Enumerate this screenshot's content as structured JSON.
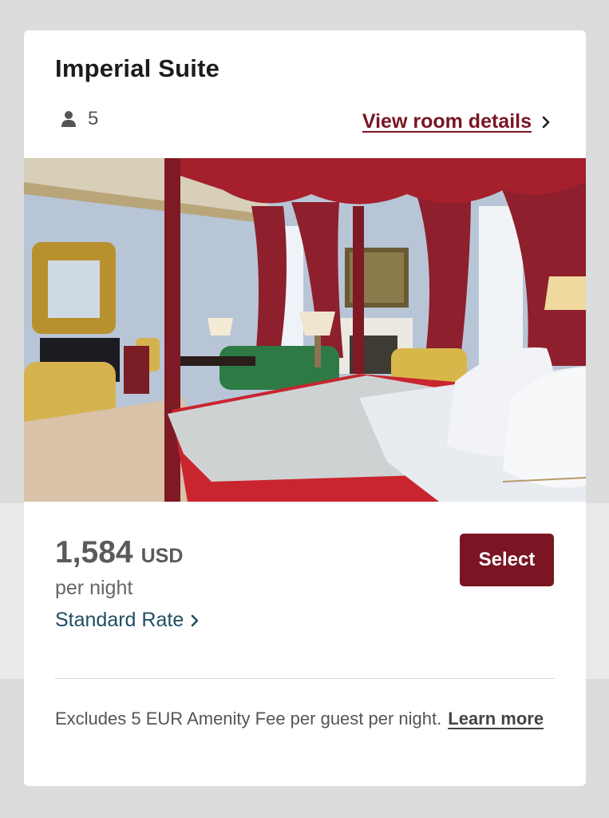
{
  "room": {
    "name": "Imperial Suite",
    "occupancy": "5",
    "details_link": "View room details",
    "photo_icon": "hotel-room-photo"
  },
  "pricing": {
    "amount": "1,584",
    "currency": "USD",
    "unit": "per night",
    "rate_name": "Standard Rate",
    "select_label": "Select"
  },
  "fee_notice": {
    "text": "Excludes 5 EUR Amenity Fee per guest per night.",
    "learn_more": "Learn more"
  },
  "colors": {
    "brand": "#7a1523",
    "rate_link": "#1f4e63",
    "text": "#1c1c1c"
  },
  "icons": {
    "occupancy": "person-icon",
    "details_chevron": "chevron-right-icon",
    "rate_chevron": "chevron-right-icon"
  }
}
